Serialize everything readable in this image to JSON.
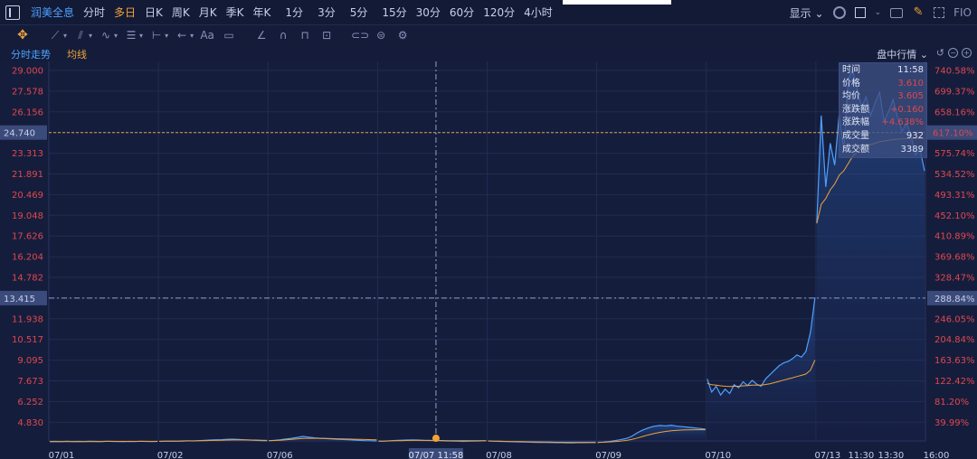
{
  "toolbar": {
    "stock_name": "润美全息",
    "periods": [
      "分时",
      "多日",
      "日K",
      "周K",
      "月K",
      "季K",
      "年K",
      "1分",
      "3分",
      "5分",
      "15分",
      "30分",
      "60分",
      "120分",
      "4小时"
    ],
    "active_period": "多日",
    "display_label": "显示",
    "fio_label": "FIO"
  },
  "draw_tools": [
    "move-icon",
    "line-icon",
    "channel-icon",
    "wave-icon",
    "fib-icon",
    "range-icon",
    "arrow-icon",
    "text-icon",
    "note-icon",
    "eraser-icon",
    "magnet-icon",
    "lock-icon",
    "delete-icon",
    "link-icon",
    "hide-icon",
    "settings-icon"
  ],
  "draw_text_label": "Aa",
  "legend": {
    "series_a": "分时走势",
    "series_b": "均线",
    "intraday_label": "盘中行情"
  },
  "colors": {
    "price_line": "#4ea1ff",
    "avg_line": "#f0a33a",
    "up": "#e0484c",
    "background": "#141c3a",
    "grid": "#222c52"
  },
  "tooltip": {
    "rows": [
      {
        "label": "时间",
        "value": "11:58",
        "red": false
      },
      {
        "label": "价格",
        "value": "3.610",
        "red": true
      },
      {
        "label": "均价",
        "value": "3.605",
        "red": true
      },
      {
        "label": "涨跌额",
        "value": "+0.160",
        "red": true
      },
      {
        "label": "涨跌幅",
        "value": "+4.638%",
        "red": true
      },
      {
        "label": "成交量",
        "value": "932",
        "red": false
      },
      {
        "label": "成交额",
        "value": "3389",
        "red": false
      }
    ]
  },
  "chart_data": {
    "type": "line",
    "ylim": [
      3.41,
      29.0
    ],
    "y_ticks": [
      "29.000",
      "27.578",
      "26.156",
      "24.735",
      "23.313",
      "21.891",
      "20.469",
      "19.048",
      "17.626",
      "16.204",
      "14.782",
      "13.415",
      "11.938",
      "10.517",
      "9.095",
      "7.673",
      "6.252",
      "4.830"
    ],
    "pct_ticks": [
      "740.58%",
      "699.37%",
      "658.16%",
      "617.10%",
      "575.74%",
      "534.52%",
      "493.31%",
      "452.10%",
      "410.89%",
      "369.68%",
      "328.47%",
      "288.84%",
      "246.05%",
      "204.84%",
      "163.63%",
      "122.42%",
      "81.20%",
      "39.99%"
    ],
    "x_labels": [
      "07/01",
      "07/02",
      "07/06",
      "07/07",
      "07/08",
      "07/09",
      "07/10",
      "07/13",
      "11:30",
      "13:30",
      "16:00"
    ],
    "crosshair": {
      "x_label": "07/07 11:58",
      "y_label": "13.415",
      "pct_label": "288.84%"
    },
    "reference": {
      "y_label": "24.740",
      "pct_label": "617.10%"
    },
    "day_segments": [
      {
        "day": "07/01",
        "x_range": [
          0.0,
          1.0
        ],
        "price": [
          3.5,
          3.51,
          3.49,
          3.52,
          3.5,
          3.51,
          3.5,
          3.52,
          3.51,
          3.5,
          3.52,
          3.51,
          3.5,
          3.49,
          3.51,
          3.5,
          3.52,
          3.51,
          3.5,
          3.51
        ],
        "avg": [
          3.5,
          3.5,
          3.5,
          3.5,
          3.5,
          3.5,
          3.5,
          3.5,
          3.5,
          3.5,
          3.51,
          3.51,
          3.51,
          3.51,
          3.51,
          3.51,
          3.51,
          3.51,
          3.51,
          3.51
        ]
      },
      {
        "day": "07/02",
        "x_range": [
          1.0,
          2.0
        ],
        "price": [
          3.51,
          3.52,
          3.53,
          3.52,
          3.54,
          3.55,
          3.54,
          3.56,
          3.58,
          3.6,
          3.62,
          3.63,
          3.65,
          3.66,
          3.64,
          3.62,
          3.6,
          3.58,
          3.56,
          3.55
        ],
        "avg": [
          3.51,
          3.52,
          3.52,
          3.53,
          3.53,
          3.54,
          3.54,
          3.55,
          3.56,
          3.57,
          3.58,
          3.59,
          3.6,
          3.61,
          3.61,
          3.61,
          3.6,
          3.6,
          3.59,
          3.58
        ]
      },
      {
        "day": "07/06",
        "x_range": [
          2.0,
          3.0
        ],
        "price": [
          3.56,
          3.58,
          3.62,
          3.68,
          3.72,
          3.78,
          3.85,
          3.8,
          3.75,
          3.72,
          3.7,
          3.68,
          3.66,
          3.64,
          3.62,
          3.6,
          3.58,
          3.56,
          3.55,
          3.54
        ],
        "avg": [
          3.56,
          3.57,
          3.59,
          3.62,
          3.65,
          3.68,
          3.71,
          3.72,
          3.72,
          3.72,
          3.71,
          3.7,
          3.69,
          3.68,
          3.67,
          3.66,
          3.65,
          3.64,
          3.63,
          3.62
        ]
      },
      {
        "day": "07/07",
        "x_range": [
          3.0,
          4.0
        ],
        "price": [
          3.52,
          3.53,
          3.55,
          3.57,
          3.59,
          3.6,
          3.61,
          3.6,
          3.58,
          3.57,
          3.56,
          3.55,
          3.54,
          3.53,
          3.52,
          3.51,
          3.52,
          3.53,
          3.54,
          3.55
        ],
        "avg": [
          3.52,
          3.53,
          3.54,
          3.55,
          3.56,
          3.57,
          3.58,
          3.58,
          3.58,
          3.58,
          3.57,
          3.57,
          3.56,
          3.56,
          3.55,
          3.55,
          3.55,
          3.55,
          3.55,
          3.55
        ]
      },
      {
        "day": "07/08",
        "x_range": [
          4.0,
          5.0
        ],
        "price": [
          3.54,
          3.52,
          3.51,
          3.5,
          3.49,
          3.48,
          3.47,
          3.46,
          3.45,
          3.44,
          3.44,
          3.43,
          3.42,
          3.42,
          3.41,
          3.41,
          3.42,
          3.42,
          3.43,
          3.43
        ],
        "avg": [
          3.54,
          3.53,
          3.52,
          3.51,
          3.5,
          3.49,
          3.49,
          3.48,
          3.47,
          3.47,
          3.46,
          3.46,
          3.45,
          3.45,
          3.44,
          3.44,
          3.44,
          3.44,
          3.44,
          3.44
        ]
      },
      {
        "day": "07/09",
        "x_range": [
          5.0,
          6.0
        ],
        "price": [
          3.44,
          3.46,
          3.5,
          3.56,
          3.62,
          3.7,
          3.85,
          4.1,
          4.3,
          4.45,
          4.55,
          4.6,
          4.58,
          4.62,
          4.55,
          4.52,
          4.48,
          4.44,
          4.4,
          4.35
        ],
        "avg": [
          3.44,
          3.45,
          3.47,
          3.5,
          3.53,
          3.57,
          3.64,
          3.74,
          3.85,
          3.96,
          4.05,
          4.13,
          4.19,
          4.24,
          4.27,
          4.29,
          4.3,
          4.31,
          4.31,
          4.31
        ]
      },
      {
        "day": "07/10",
        "x_range": [
          6.0,
          7.0
        ],
        "price": [
          7.8,
          6.9,
          7.3,
          6.7,
          7.1,
          6.8,
          7.4,
          7.2,
          7.6,
          7.35,
          7.7,
          7.45,
          7.3,
          7.8,
          8.1,
          8.4,
          8.7,
          8.9,
          9.0,
          9.2,
          9.45,
          9.3,
          9.7,
          11.0,
          13.4
        ],
        "avg": [
          7.5,
          7.4,
          7.38,
          7.33,
          7.3,
          7.28,
          7.3,
          7.3,
          7.33,
          7.34,
          7.37,
          7.38,
          7.38,
          7.42,
          7.47,
          7.55,
          7.63,
          7.72,
          7.8,
          7.88,
          7.97,
          8.05,
          8.14,
          8.4,
          9.1
        ]
      },
      {
        "day": "07/13",
        "x_range": [
          7.0,
          8.0
        ],
        "price": [
          18.5,
          25.9,
          21.0,
          24.0,
          22.5,
          26.0,
          23.5,
          28.4,
          29.0,
          27.8,
          26.5,
          27.2,
          25.9,
          26.8,
          27.5,
          25.5,
          26.2,
          27.0,
          25.8,
          24.8,
          25.4,
          24.5,
          23.2,
          23.6,
          22.1
        ],
        "avg": [
          18.5,
          19.8,
          20.2,
          20.8,
          21.2,
          21.8,
          22.1,
          22.6,
          23.1,
          23.4,
          23.6,
          23.8,
          23.9,
          24.0,
          24.1,
          24.15,
          24.2,
          24.25,
          24.28,
          24.3,
          24.32,
          24.33,
          24.33,
          24.33,
          24.32
        ]
      }
    ]
  }
}
